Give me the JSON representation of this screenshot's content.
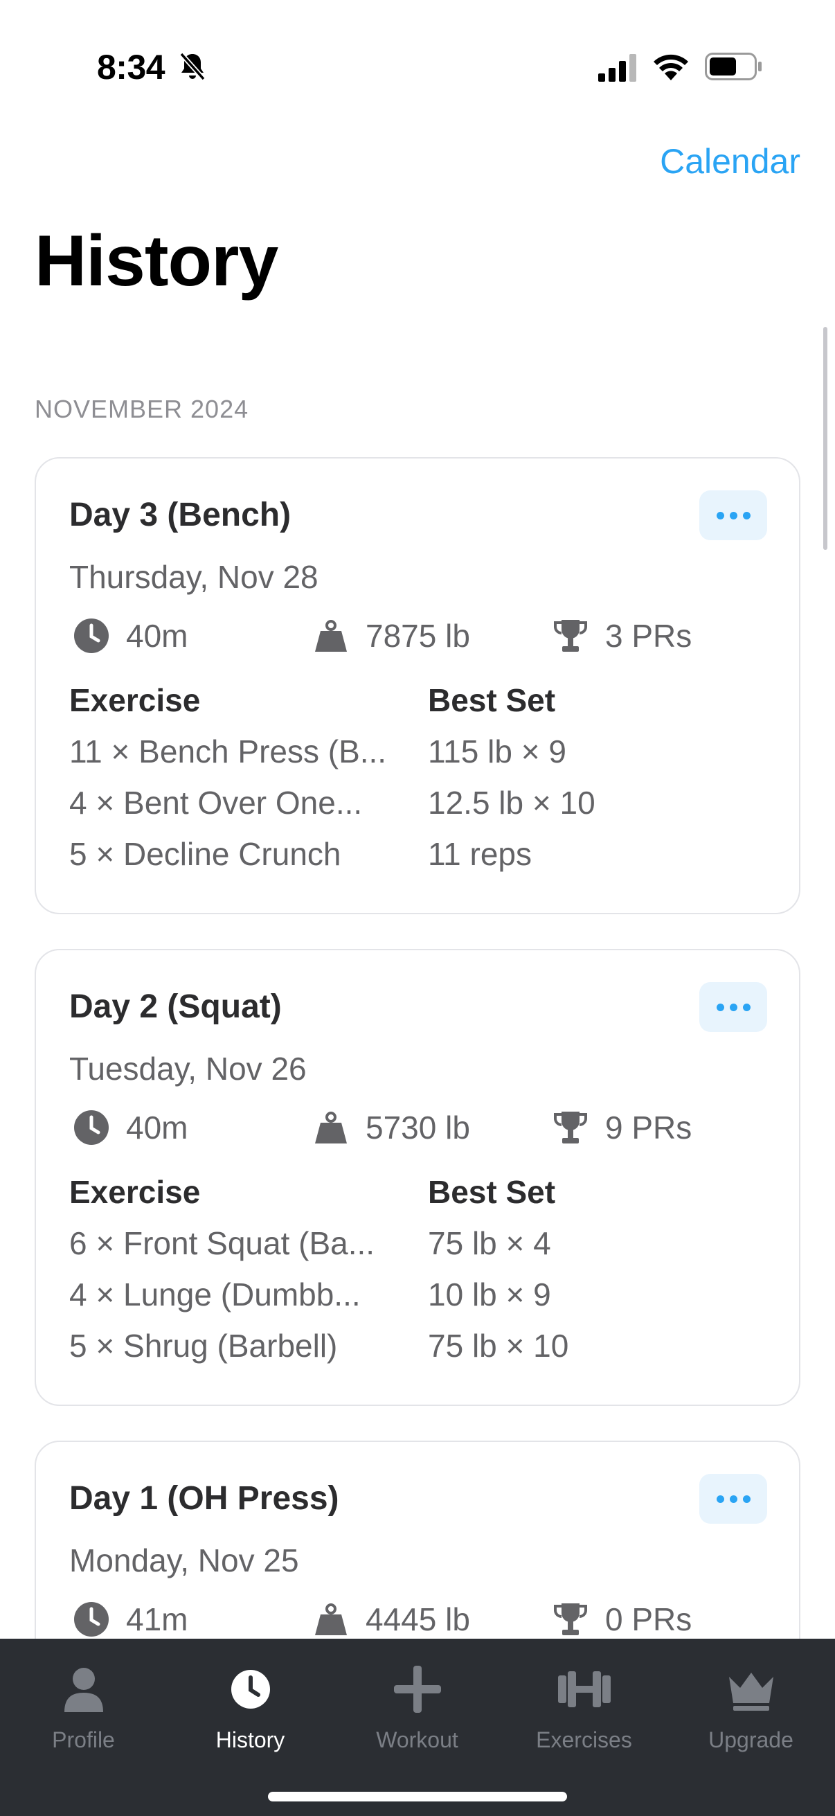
{
  "status_bar": {
    "time": "8:34"
  },
  "nav": {
    "calendar_label": "Calendar",
    "title": "History"
  },
  "section": {
    "header": "NOVEMBER 2024"
  },
  "columns": {
    "exercise": "Exercise",
    "best_set": "Best Set"
  },
  "workouts": [
    {
      "title": "Day 3 (Bench)",
      "date": "Thursday, Nov 28",
      "duration": "40m",
      "volume": "7875 lb",
      "prs": "3 PRs",
      "rows": [
        {
          "exercise": "11 × Bench Press (B...",
          "best": "115 lb × 9"
        },
        {
          "exercise": "4 × Bent Over One...",
          "best": "12.5 lb × 10"
        },
        {
          "exercise": "5 × Decline Crunch",
          "best": "11 reps"
        }
      ]
    },
    {
      "title": "Day 2 (Squat)",
      "date": "Tuesday, Nov 26",
      "duration": "40m",
      "volume": "5730 lb",
      "prs": "9 PRs",
      "rows": [
        {
          "exercise": "6 × Front Squat (Ba...",
          "best": "75 lb × 4"
        },
        {
          "exercise": "4 × Lunge (Dumbb...",
          "best": "10 lb × 9"
        },
        {
          "exercise": "5 × Shrug (Barbell)",
          "best": "75 lb × 10"
        }
      ]
    },
    {
      "title": "Day 1 (OH Press)",
      "date": "Monday, Nov 25",
      "duration": "41m",
      "volume": "4445 lb",
      "prs": "0 PRs"
    }
  ],
  "tabs": [
    {
      "label": "Profile",
      "icon": "profile-icon"
    },
    {
      "label": "History",
      "icon": "clock-icon"
    },
    {
      "label": "Workout",
      "icon": "plus-icon"
    },
    {
      "label": "Exercises",
      "icon": "dumbbell-icon"
    },
    {
      "label": "Upgrade",
      "icon": "crown-icon"
    }
  ],
  "colors": {
    "accent": "#2aa4f4",
    "tab_bar": "#2b2e33"
  }
}
